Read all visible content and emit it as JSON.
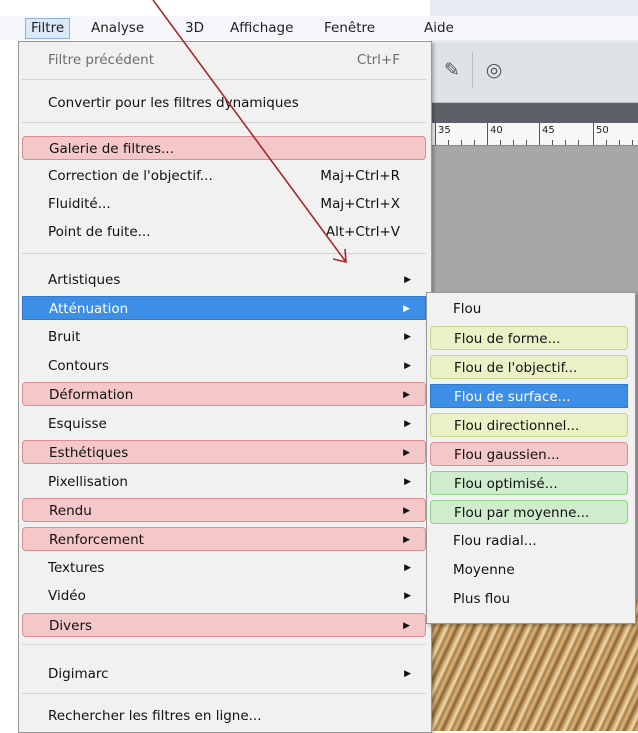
{
  "menubar": {
    "items": [
      {
        "label": "Filtre"
      },
      {
        "label": "Analyse"
      },
      {
        "label": "3D"
      },
      {
        "label": "Affichage"
      },
      {
        "label": "Fenêtre"
      },
      {
        "label": "Aide"
      }
    ]
  },
  "filter_menu": {
    "items": [
      {
        "label": "Filtre précédent",
        "shortcut": "Ctrl+F",
        "state": "disabled"
      },
      {
        "label": "Convertir pour les filtres dynamiques"
      },
      {
        "label": "Galerie de filtres...",
        "highlight": "pink"
      },
      {
        "label": "Correction de l'objectif...",
        "shortcut": "Maj+Ctrl+R"
      },
      {
        "label": "Fluidité...",
        "shortcut": "Maj+Ctrl+X"
      },
      {
        "label": "Point de fuite...",
        "shortcut": "Alt+Ctrl+V"
      },
      {
        "label": "Artistiques",
        "submenu": true
      },
      {
        "label": "Atténuation",
        "submenu": true,
        "highlight": "blue",
        "state": "open"
      },
      {
        "label": "Bruit",
        "submenu": true
      },
      {
        "label": "Contours",
        "submenu": true
      },
      {
        "label": "Déformation",
        "submenu": true,
        "highlight": "pink"
      },
      {
        "label": "Esquisse",
        "submenu": true
      },
      {
        "label": "Esthétiques",
        "submenu": true,
        "highlight": "pink"
      },
      {
        "label": "Pixellisation",
        "submenu": true
      },
      {
        "label": "Rendu",
        "submenu": true,
        "highlight": "pink"
      },
      {
        "label": "Renforcement",
        "submenu": true,
        "highlight": "pink"
      },
      {
        "label": "Textures",
        "submenu": true
      },
      {
        "label": "Vidéo",
        "submenu": true
      },
      {
        "label": "Divers",
        "submenu": true,
        "highlight": "pink"
      },
      {
        "label": "Digimarc",
        "submenu": true
      },
      {
        "label": "Rechercher les filtres en ligne..."
      }
    ]
  },
  "blur_submenu": {
    "items": [
      {
        "label": "Flou"
      },
      {
        "label": "Flou de forme...",
        "highlight": "yellow"
      },
      {
        "label": "Flou de l'objectif...",
        "highlight": "yellow"
      },
      {
        "label": "Flou de surface...",
        "highlight": "blue"
      },
      {
        "label": "Flou directionnel...",
        "highlight": "yellow"
      },
      {
        "label": "Flou gaussien...",
        "highlight": "pink"
      },
      {
        "label": "Flou optimisé...",
        "highlight": "green"
      },
      {
        "label": "Flou par moyenne...",
        "highlight": "green"
      },
      {
        "label": "Flou radial..."
      },
      {
        "label": "Moyenne"
      },
      {
        "label": "Plus flou"
      }
    ]
  },
  "ruler": {
    "labels": [
      "35",
      "40",
      "45",
      "50"
    ]
  },
  "toolbar_icons": [
    "brush-tool-icon",
    "target-brush-icon"
  ],
  "colors": {
    "selection_blue": "#3d8ee6",
    "pink_highlight": "#f4c7c9",
    "yellow_highlight": "#eaf1c6",
    "green_highlight": "#cfeccd",
    "annotation_arrow": "#a52a2a"
  }
}
